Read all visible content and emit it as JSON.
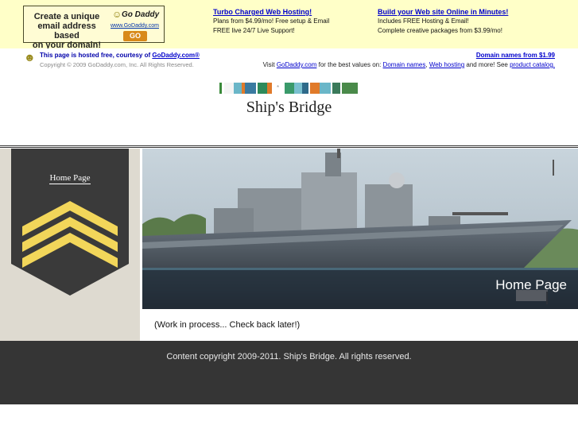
{
  "ad": {
    "box_lines": [
      "Create a unique",
      "email address based",
      "on your domain!"
    ],
    "logo_brand": "Go Daddy",
    "logo_url": "www.GoDaddy.com",
    "go_label": "GO",
    "promos": [
      {
        "title": "Turbo Charged Web Hosting!",
        "lines": [
          "Plans from $4.99/mo! Free setup & Email",
          "FREE live 24/7 Live Support!"
        ]
      },
      {
        "title": "Build your Web site Online in Minutes!",
        "lines": [
          "Includes FREE Hosting & Email!",
          "Complete creative packages from $3.99/mo!"
        ]
      }
    ]
  },
  "hosted": {
    "line1_prefix": "This page is hosted free, courtesy of ",
    "line1_link": "GoDaddy.com®",
    "copyright": "Copyright © 2009 GoDaddy.com, Inc. All Rights Reserved.",
    "domain_link": "Domain names from $1.99",
    "visit_prefix": "Visit ",
    "visit_link": "GoDaddy.com",
    "visit_mid": " for the best values on: ",
    "link_domains": "Domain names",
    "sep": ", ",
    "link_hosting": "Web hosting",
    "visit_mid2": " and more! See ",
    "link_catalog": "product catalog."
  },
  "site": {
    "title": "Ship's Bridge",
    "nav_home": "Home Page",
    "hero_caption": "Home Page",
    "content": "(Work in process...  Check back later!)",
    "footer": "Content copyright 2009-2011. Ship's Bridge. All rights reserved."
  },
  "colors": {
    "ad_bg": "#ffffc8",
    "sidebar_bg": "#dedad0",
    "chevron_panel": "#3a3a3a",
    "chevron_gold": "#f2d65a",
    "footer_bg": "#353535",
    "link": "#0000cc"
  }
}
